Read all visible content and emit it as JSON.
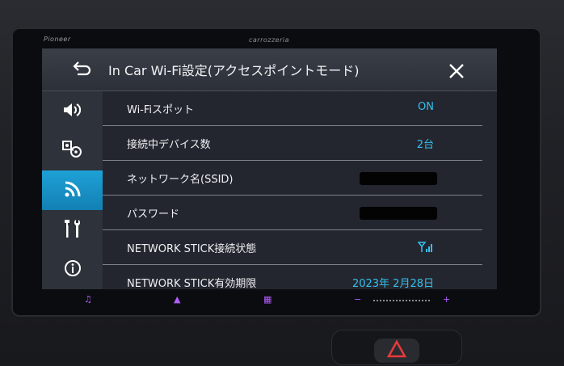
{
  "brand": {
    "left": "Pioneer",
    "center": "carrozzeria"
  },
  "header": {
    "title": "In Car Wi-Fi設定(アクセスポイントモード)"
  },
  "sidebar": {
    "items": [
      {
        "icon": "volume-icon"
      },
      {
        "icon": "devices-icon"
      },
      {
        "icon": "wifi-icon",
        "active": true
      },
      {
        "icon": "tools-icon"
      },
      {
        "icon": "info-icon"
      }
    ]
  },
  "rows": [
    {
      "label": "Wi-Fiスポット",
      "value": "ON"
    },
    {
      "label": "接続中デバイス数",
      "value": "2台"
    },
    {
      "label": "ネットワーク名(SSID)",
      "value": ""
    },
    {
      "label": "パスワード",
      "value": ""
    },
    {
      "label": "NETWORK STICK接続状態",
      "value": ""
    },
    {
      "label": "NETWORK STICK有効期限",
      "value": "2023年 2月28日"
    }
  ],
  "hardware": {
    "minus": "−",
    "plus": "+"
  },
  "colors": {
    "accent": "#34c0ef",
    "active_tab": "#1a93c8",
    "hw_led": "#b45cff",
    "hazard": "#e63a3a"
  }
}
